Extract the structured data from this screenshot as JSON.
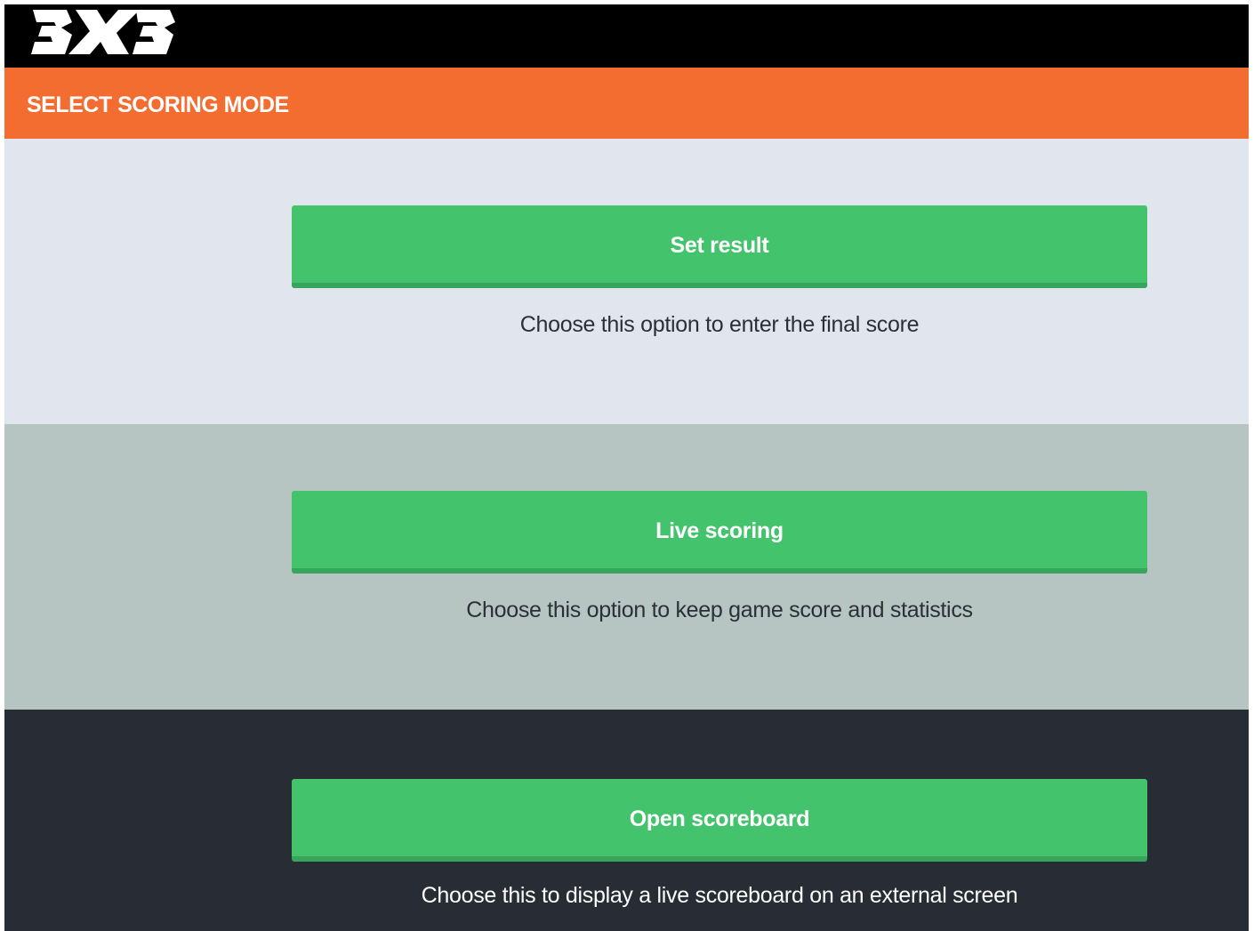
{
  "app": {
    "logo_icon": "fiba-3x3-logo"
  },
  "header": {
    "title": "SELECT SCORING MODE"
  },
  "modes": [
    {
      "button_label": "Set result",
      "description": "Choose this option to enter the final score"
    },
    {
      "button_label": "Live scoring",
      "description": "Choose this option to keep game score and statistics"
    },
    {
      "button_label": "Open scoreboard",
      "description": "Choose this to display a live scoreboard on an external screen"
    }
  ],
  "colors": {
    "topbar": "#000000",
    "header": "#f46d30",
    "section_light": "#e1e5ed",
    "section_mid": "#b6c4c2",
    "section_dark": "#282c35",
    "button": "#44c36d",
    "button_shadow": "#37a55b"
  }
}
